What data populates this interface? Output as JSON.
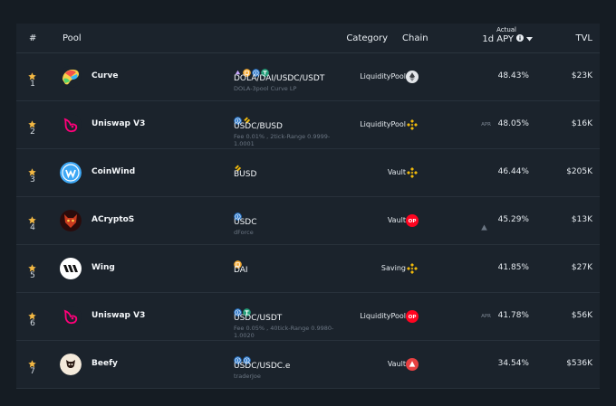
{
  "header": {
    "rank": "#",
    "pool": "Pool",
    "category": "Category",
    "chain": "Chain",
    "apy_top": "Actual",
    "apy_main": "1d APY",
    "tvl": "TVL"
  },
  "rows": [
    {
      "rank": "1",
      "name": "Curve",
      "logo": "curve-logo",
      "tokens": [
        "dola-token-icon",
        "dai-token-icon",
        "usdc-token-icon",
        "usdt-token-icon"
      ],
      "pair": "DOLA/DAI/USDC/USDT",
      "sub": "DOLA-3pool Curve LP",
      "category": "LiquidityPool",
      "chain": "ethereum-chain-icon",
      "apy_prefix": "",
      "apy": "48.43%",
      "tvl": "$23K"
    },
    {
      "rank": "2",
      "name": "Uniswap V3",
      "logo": "uniswap-logo",
      "tokens": [
        "usdc-token-icon",
        "busd-token-icon"
      ],
      "pair": "USDC/BUSD",
      "sub": "Fee 0.01% , 2tick-Range 0.9999-1.0001",
      "category": "LiquidityPool",
      "chain": "bnb-chain-icon",
      "apy_prefix": "APR",
      "apy": "48.05%",
      "tvl": "$16K"
    },
    {
      "rank": "3",
      "name": "CoinWind",
      "logo": "coinwind-logo",
      "tokens": [
        "busd-token-icon"
      ],
      "pair": "BUSD",
      "sub": "",
      "category": "Vault",
      "chain": "bnb-chain-icon",
      "apy_prefix": "",
      "apy": "46.44%",
      "tvl": "$205K"
    },
    {
      "rank": "4",
      "name": "ACryptoS",
      "logo": "acryptos-logo",
      "tokens": [
        "usdc-token-icon"
      ],
      "pair": "USDC",
      "sub": "dForce",
      "category": "Vault",
      "chain": "optimism-chain-icon",
      "apy_prefix": "",
      "apy": "45.29%",
      "tvl": "$13K"
    },
    {
      "rank": "5",
      "name": "Wing",
      "logo": "wing-logo",
      "tokens": [
        "dai-token-icon"
      ],
      "pair": "DAI",
      "sub": "",
      "category": "Saving",
      "chain": "bnb-chain-icon",
      "apy_prefix": "",
      "apy": "41.85%",
      "tvl": "$27K"
    },
    {
      "rank": "6",
      "name": "Uniswap V3",
      "logo": "uniswap-logo",
      "tokens": [
        "usdc-token-icon",
        "usdt-token-icon"
      ],
      "pair": "USDC/USDT",
      "sub": "Fee 0.05% , 40tick-Range 0.9980-1.0020",
      "category": "LiquidityPool",
      "chain": "optimism-chain-icon",
      "apy_prefix": "APR",
      "apy": "41.78%",
      "tvl": "$56K"
    },
    {
      "rank": "7",
      "name": "Beefy",
      "logo": "beefy-logo",
      "tokens": [
        "usdc-token-icon",
        "usdc-token-icon"
      ],
      "pair": "USDC/USDC.e",
      "sub": "traderJoe",
      "category": "Vault",
      "chain": "avalanche-chain-icon",
      "apy_prefix": "",
      "apy": "34.54%",
      "tvl": "$536K"
    }
  ],
  "colors": {
    "background": "#151c23",
    "panel": "#1b232c",
    "star": "#f3b843",
    "usdc": "#2775ca",
    "usdt": "#26a17b",
    "dai": "#f5ac37",
    "bnb": "#f0b90b",
    "optimism": "#ff0420",
    "avalanche": "#e84142"
  }
}
